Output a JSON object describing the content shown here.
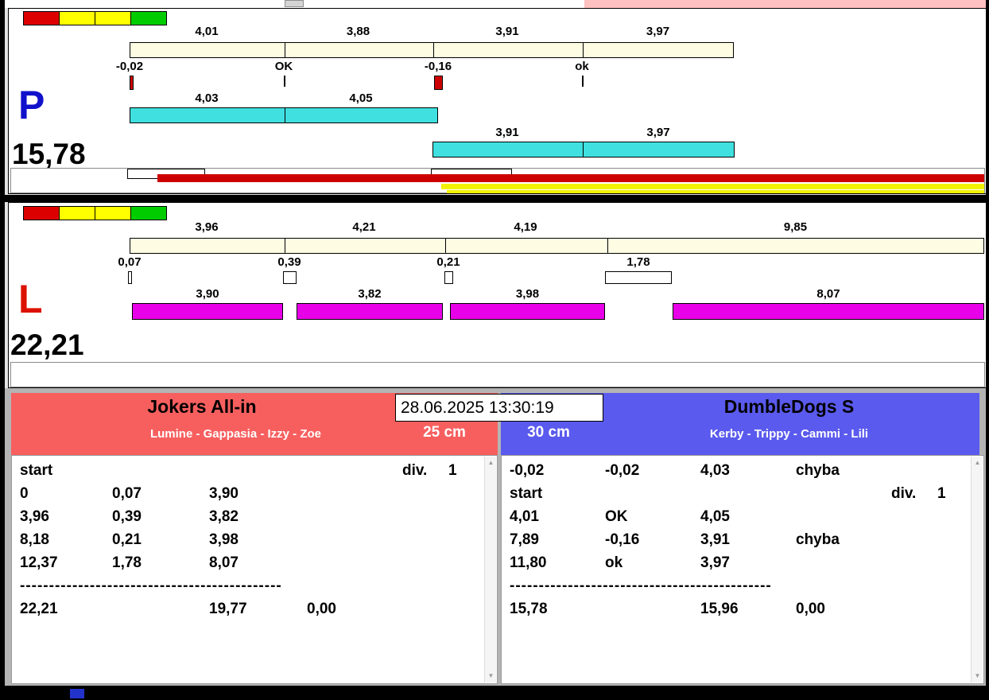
{
  "colors": {
    "lamp-red": "#dd0000",
    "lamp-yellow": "#ffff00",
    "lamp-green": "#00cc00",
    "ivory": "#fefce2",
    "cyan": "#40e0e0",
    "magenta": "#e800e8",
    "bar-red": "#cc0000",
    "bar-yellow": "#f2f200",
    "team-red": "#f75f5f",
    "team-blue": "#5a5aee",
    "pink-strip": "#ffc0c0",
    "p-letter": "#1111cc",
    "l-letter": "#dd1100",
    "taskbar-blue": "#2233cc"
  },
  "lane_p": {
    "letter": "P",
    "total": "15,78",
    "split_labels": [
      "4,01",
      "3,88",
      "3,91",
      "3,97"
    ],
    "change_labels": [
      "-0,02",
      "OK",
      "-0,16",
      "ok"
    ],
    "run1_labels": [
      "4,03",
      "4,05"
    ],
    "run2_labels": [
      "3,91",
      "3,97"
    ]
  },
  "lane_l": {
    "letter": "L",
    "total": "22,21",
    "split_labels": [
      "3,96",
      "4,21",
      "4,19",
      "9,85"
    ],
    "change_labels": [
      "0,07",
      "0,39",
      "0,21",
      "1,78"
    ],
    "run_labels": [
      "3,90",
      "3,82",
      "3,98",
      "8,07"
    ]
  },
  "clock": "28.06.2025 13:30:19",
  "left_team": {
    "name": "Jokers All-in",
    "dogs": "Lumine - Gappasia - Izzy - Zoe",
    "height": "25 cm",
    "rows": [
      [
        "start",
        "",
        "",
        "",
        "div.",
        "1"
      ],
      [
        "0",
        "0,07",
        "3,90",
        "",
        "",
        ""
      ],
      [
        "3,96",
        "0,39",
        "3,82",
        "",
        "",
        ""
      ],
      [
        "8,18",
        "0,21",
        "3,98",
        "",
        "",
        ""
      ],
      [
        "12,37",
        "1,78",
        "8,07",
        "",
        "",
        ""
      ]
    ],
    "separator": "---------------------------------------------",
    "totals": [
      "22,21",
      "19,77",
      "0,00"
    ]
  },
  "right_team": {
    "name": "DumbleDogs S",
    "dogs": "Kerby - Trippy - Cammi - Lili",
    "height": "30 cm",
    "rows": [
      [
        "-0,02",
        "-0,02",
        "4,03",
        "chyba",
        "",
        ""
      ],
      [
        "start",
        "",
        "",
        "",
        "div.",
        "1"
      ],
      [
        "4,01",
        "OK",
        "4,05",
        "",
        "",
        ""
      ],
      [
        "7,89",
        "-0,16",
        "3,91",
        "chyba",
        "",
        ""
      ],
      [
        "11,80",
        "ok",
        "3,97",
        "",
        "",
        ""
      ]
    ],
    "separator": "---------------------------------------------",
    "totals": [
      "15,78",
      "15,96",
      "0,00"
    ]
  }
}
